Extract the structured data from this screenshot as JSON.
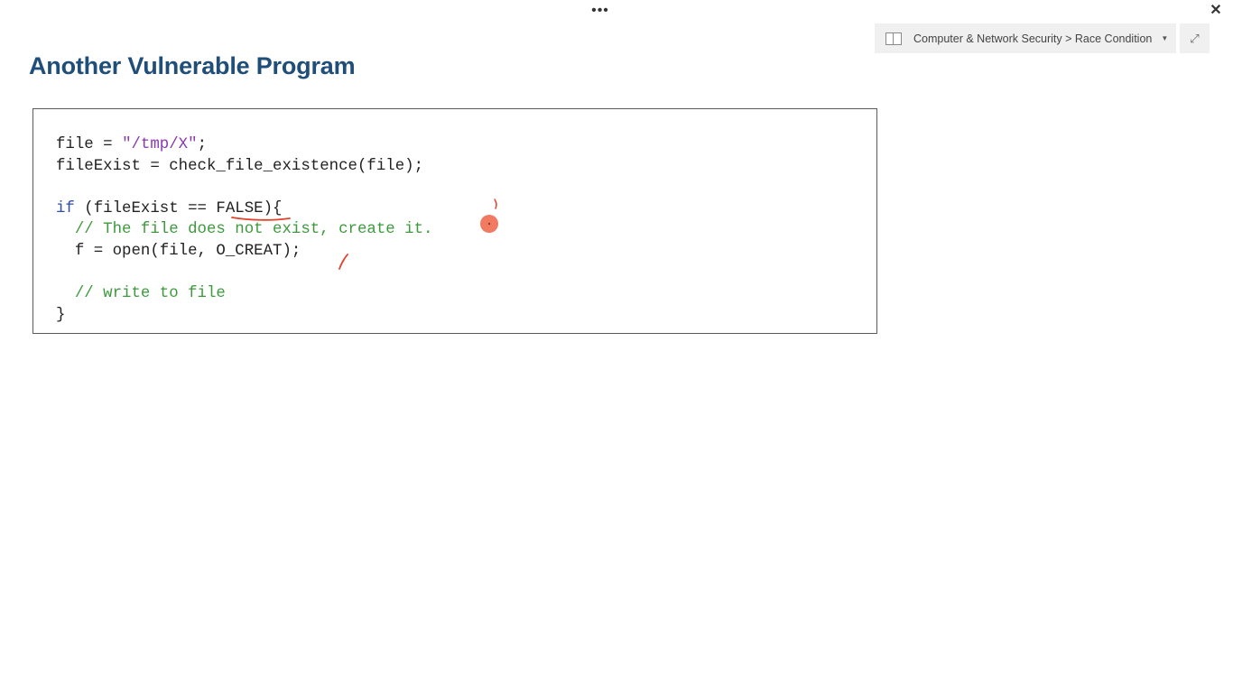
{
  "window": {
    "more_label": "•••",
    "close_label": "✕",
    "expand_label": "⤢"
  },
  "breadcrumb": {
    "notebook_icon": "notebook-icon",
    "text": "Computer & Network Security > Race Condition",
    "caret": "▼"
  },
  "slide": {
    "title": "Another Vulnerable Program",
    "code": {
      "line1": {
        "a": "file = ",
        "b": "\"/tmp/X\"",
        "c": ";"
      },
      "line2": "fileExist = check_file_existence(file);",
      "line4": {
        "kw": "if",
        "rest": " (fileExist == FALSE){"
      },
      "line5": "  // The file does not exist, create it.",
      "line6": "  f = open(file, O_CREAT);",
      "line8": "  // write to file",
      "line9": "}"
    }
  },
  "colors": {
    "title": "#1f4e79",
    "string": "#8a39b0",
    "keyword": "#2f4fa8",
    "comment": "#3c9a3c",
    "ink": "#e0422a",
    "pointer": "#f07a62"
  }
}
